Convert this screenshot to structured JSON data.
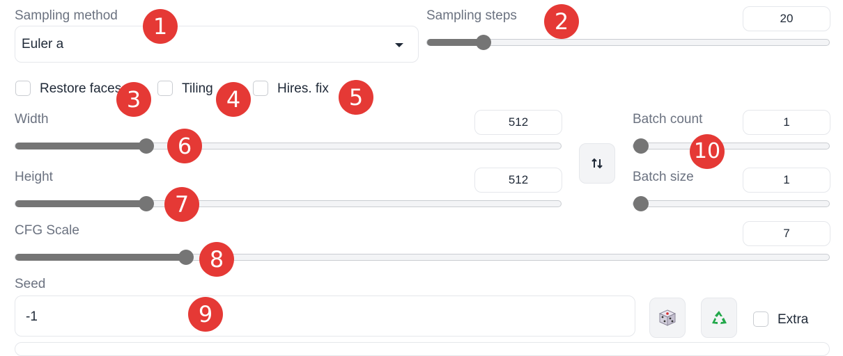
{
  "sampling_method": {
    "label": "Sampling method",
    "value": "Euler a"
  },
  "sampling_steps": {
    "label": "Sampling steps",
    "value": "20",
    "level": 0.14
  },
  "checkboxes": [
    {
      "label": "Restore faces",
      "checked": false
    },
    {
      "label": "Tiling",
      "checked": false
    },
    {
      "label": "Hires. fix",
      "checked": false
    }
  ],
  "width": {
    "label": "Width",
    "value": "512",
    "level": 0.24
  },
  "height": {
    "label": "Height",
    "value": "512",
    "level": 0.24
  },
  "batch_count": {
    "label": "Batch count",
    "value": "1",
    "level": 0.0
  },
  "batch_size": {
    "label": "Batch size",
    "value": "1",
    "level": 0.0
  },
  "cfg_scale": {
    "label": "CFG Scale",
    "value": "7",
    "level": 0.21
  },
  "seed": {
    "label": "Seed",
    "value": "-1"
  },
  "extra": {
    "label": "Extra",
    "checked": false
  },
  "swap_icon": "swap-vertical-icon",
  "dice_icon": "dice-icon",
  "recycle_icon": "recycle-icon",
  "badges": [
    "1",
    "2",
    "3",
    "4",
    "5",
    "6",
    "7",
    "8",
    "9",
    "10"
  ],
  "colors": {
    "badge": "#e53935",
    "slider": "#757575"
  }
}
